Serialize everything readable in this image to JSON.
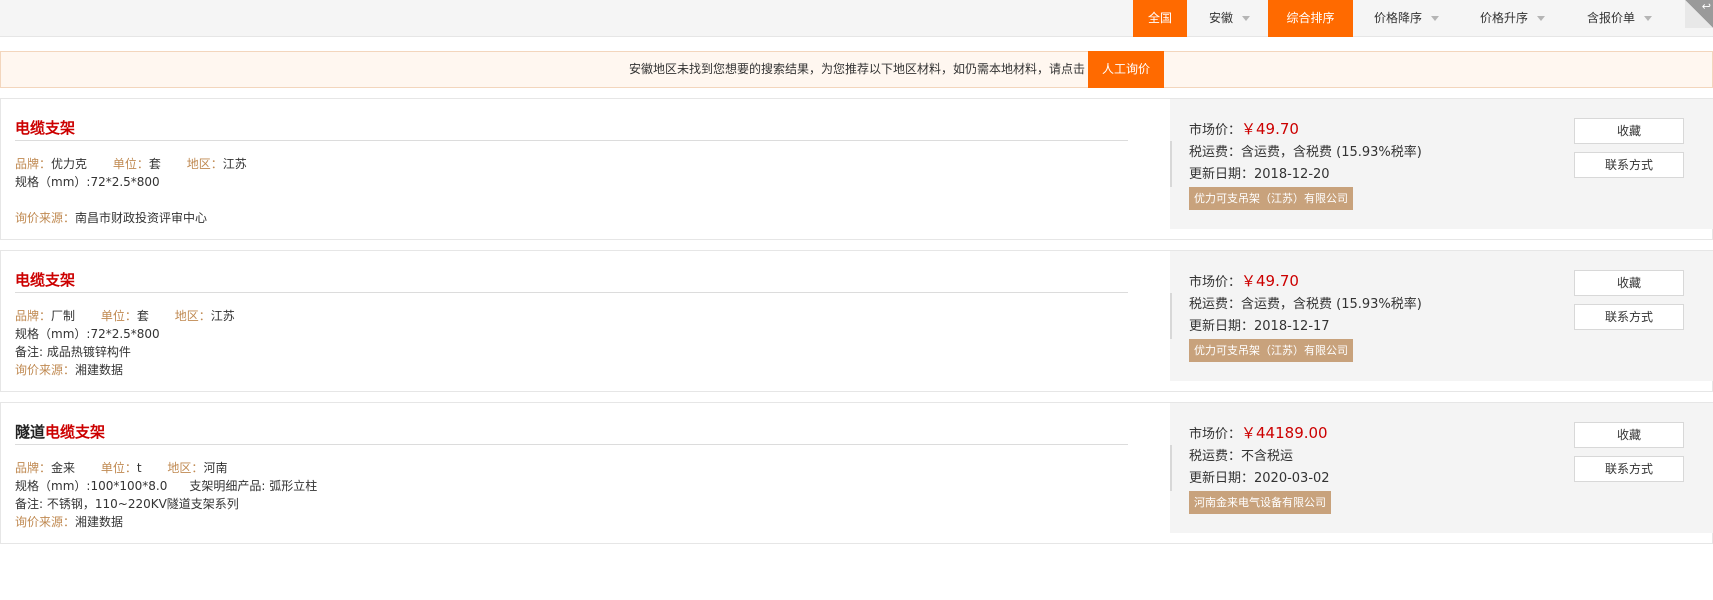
{
  "filter_bar": {
    "items": [
      {
        "label": "全国",
        "active": true,
        "dropdown": false
      },
      {
        "label": "安徽",
        "active": false,
        "dropdown": true
      },
      {
        "label": "综合排序",
        "active": true,
        "dropdown": false
      },
      {
        "label": "价格降序",
        "active": false,
        "dropdown": true
      },
      {
        "label": "价格升序",
        "active": false,
        "dropdown": true
      },
      {
        "label": "含报价单",
        "active": false,
        "dropdown": true
      }
    ],
    "accent_color": "#ff6a00"
  },
  "notice": {
    "text": "安徽地区未找到您想要的搜索结果，为您推荐以下地区材料，如仍需本地材料，请点击",
    "button": "人工询价"
  },
  "labels": {
    "brand": "品牌：",
    "unit": "单位：",
    "region": "地区：",
    "spec": "规格（mm）:",
    "source": "询价来源：",
    "market_price": "市场价：",
    "tax_shipping": "税运费：",
    "update_date": "更新日期：",
    "favorite": "收藏",
    "contact": "联系方式"
  },
  "results": [
    {
      "title_prefix": "",
      "title_highlight": "电缆支架",
      "brand": "优力克",
      "unit": "套",
      "region": "江苏",
      "spec": "72*2.5*800",
      "note": "",
      "source": "南昌市财政投资评审中心",
      "price": "￥49.70",
      "tax_shipping": "含运费，含税费 (15.93%税率)",
      "update_date": "2018-12-20",
      "company": "优力可支吊架（江苏）有限公司"
    },
    {
      "title_prefix": "",
      "title_highlight": "电缆支架",
      "brand": "厂制",
      "unit": "套",
      "region": "江苏",
      "spec": "72*2.5*800",
      "note": "备注: 成品热镀锌构件",
      "source": "湘建数据",
      "price": "￥49.70",
      "tax_shipping": "含运费，含税费 (15.93%税率)",
      "update_date": "2018-12-17",
      "company": "优力可支吊架（江苏）有限公司"
    },
    {
      "title_prefix": "隧道",
      "title_highlight": "电缆支架",
      "brand": "金来",
      "unit": "t",
      "region": "河南",
      "spec": "100*100*8.0",
      "spec_extra": "支架明细产品: 弧形立柱",
      "note": "备注: 不锈钢，110~220KV隧道支架系列",
      "source": "湘建数据",
      "price": "￥44189.00",
      "tax_shipping": "不含税运",
      "update_date": "2020-03-02",
      "company": "河南金来电气设备有限公司"
    }
  ]
}
